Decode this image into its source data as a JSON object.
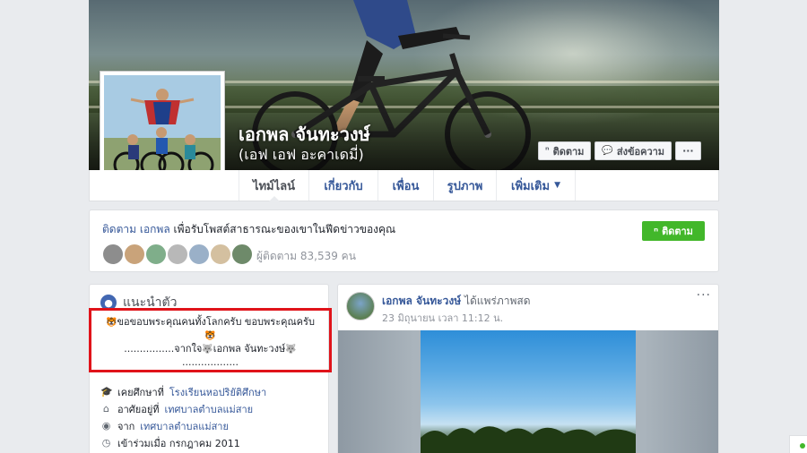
{
  "profile": {
    "name": "เอกพล จันทะวงษ์",
    "alternate_name": "(เอฟ เอฟ อะคาเดมี่)"
  },
  "cover_buttons": {
    "follow_label": "ติดตาม",
    "message_label": "ส่งข้อความ",
    "more_label": "···"
  },
  "tabs": [
    {
      "label": "ไทม์ไลน์"
    },
    {
      "label": "เกี่ยวกับ"
    },
    {
      "label": "เพื่อน"
    },
    {
      "label": "รูปภาพ"
    },
    {
      "label": "เพิ่มเติม"
    }
  ],
  "follow_box": {
    "link_text": "ติดตาม เอกพล",
    "text": " เพื่อรับโพสต์สาธารณะของเขาในฟีดข่าวของคุณ",
    "followers_text": "ผู้ติดตาม 83,539 คน",
    "button_label": "ติดตาม"
  },
  "intro": {
    "title": "แนะนำตัว",
    "bio_line1": "ขอขอบพระคุณคนทั้งโลกครับ ขอบพระคุณครับ",
    "bio_line2": "................จากใจ",
    "bio_name": "เอกพล จันทะวงษ์",
    "bio_line3": "..................",
    "items": [
      {
        "prefix": "เคยศึกษาที่ ",
        "link": "โรงเรียนหอปริยัติศึกษา",
        "icon": "graduation-cap-icon"
      },
      {
        "prefix": "อาศัยอยู่ที่ ",
        "link": "เทศบาลตำบลแม่สาย",
        "icon": "home-icon"
      },
      {
        "prefix": "จาก ",
        "link": "เทศบาลตำบลแม่สาย",
        "icon": "location-pin-icon"
      },
      {
        "prefix": "เข้าร่วมเมื่อ กรกฎาคม 2011",
        "link": "",
        "icon": "clock-icon"
      }
    ]
  },
  "post": {
    "author": "เอกพล จันทะวงษ์",
    "action": " ได้แพร่ภาพสด",
    "time": "23 มิถุนายน เวลา 11:12 น.",
    "more_label": "···"
  },
  "colors": {
    "link": "#365899",
    "follow_green": "#42b72a",
    "highlight_red": "#e0131a",
    "page_bg": "#e9ebee"
  }
}
